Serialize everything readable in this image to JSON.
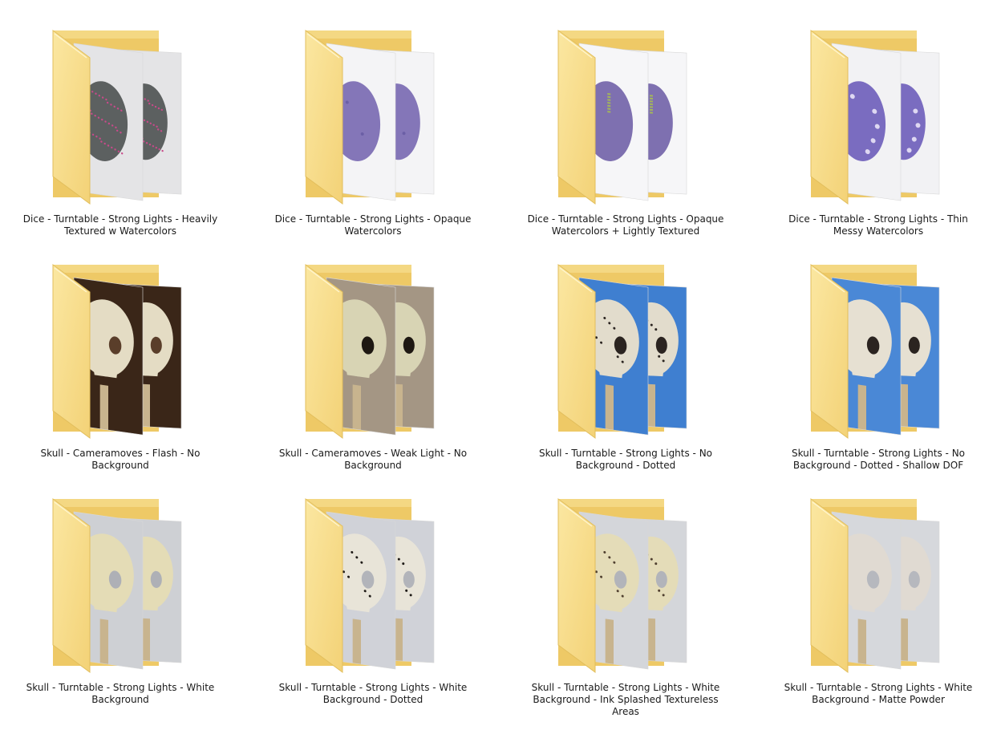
{
  "folders": [
    {
      "label": "Dice - Turntable - Strong Lights - Heavily Textured w Watercolors",
      "preview": "dice-speckled",
      "colors": {
        "bg": "#e4e4e6",
        "obj": "#5c6060",
        "fleck": "#c84a8a",
        "shade": "#9a9a9e"
      }
    },
    {
      "label": "Dice - Turntable - Strong Lights - Opaque Watercolors",
      "preview": "dice-purple",
      "colors": {
        "bg": "#f4f4f6",
        "obj": "#8476b8",
        "fleck": "#6b5fa6",
        "shade": "#b4b4bc"
      }
    },
    {
      "label": "Dice - Turntable - Strong Lights - Opaque Watercolors + Lightly Textured",
      "preview": "dice-purple-green",
      "colors": {
        "bg": "#f6f6f8",
        "obj": "#7e70b0",
        "fleck": "#a4b65a",
        "shade": "#b8b8c0"
      }
    },
    {
      "label": "Dice - Turntable - Strong Lights - Thin Messy Watercolors",
      "preview": "dice-purple-dots",
      "colors": {
        "bg": "#f2f2f4",
        "obj": "#7a6cc0",
        "fleck": "#ded8f2",
        "shade": "#b4b4bc"
      }
    },
    {
      "label": "Skull - Cameramoves - Flash - No Background",
      "preview": "skull-flash",
      "colors": {
        "bg": "#3a2618",
        "obj": "#e4dcc4",
        "fleck": "#a89878",
        "shade": "#5a3e2a"
      }
    },
    {
      "label": "Skull - Cameramoves - Weak Light - No Background",
      "preview": "skull-weak",
      "colors": {
        "bg": "#a49684",
        "obj": "#d8d4b4",
        "fleck": "#8e8a70",
        "shade": "#1e1812"
      }
    },
    {
      "label": "Skull - Turntable - Strong Lights - No Background - Dotted",
      "preview": "skull-blue",
      "colors": {
        "bg": "#3f7fd0",
        "obj": "#e2dccc",
        "fleck": "#2b2420",
        "shade": "#2d63ad"
      }
    },
    {
      "label": "Skull - Turntable - Strong Lights - No Background - Dotted - Shallow DOF",
      "preview": "skull-blue-dof",
      "colors": {
        "bg": "#4a88d6",
        "obj": "#e6e0d2",
        "fleck": "#2b2420",
        "shade": "#3266b0"
      }
    },
    {
      "label": "Skull - Turntable - Strong Lights - White Background",
      "preview": "skull-white",
      "colors": {
        "bg": "#ced0d4",
        "obj": "#e4dcb6",
        "fleck": "#6a5a34",
        "shade": "#aeb0b6"
      }
    },
    {
      "label": "Skull - Turntable - Strong Lights - White Background - Dotted",
      "preview": "skull-white-dotted",
      "colors": {
        "bg": "#d0d2d8",
        "obj": "#e8e4d8",
        "fleck": "#1e1a16",
        "shade": "#b2b4ba"
      }
    },
    {
      "label": "Skull - Turntable - Strong Lights - White Background - Ink Splashed Textureless Areas",
      "preview": "skull-white-ink",
      "colors": {
        "bg": "#d4d6da",
        "obj": "#e4dcb8",
        "fleck": "#504030",
        "shade": "#b2b4ba"
      }
    },
    {
      "label": "Skull - Turntable - Strong Lights - White Background - Matte Powder",
      "preview": "skull-white-matte",
      "colors": {
        "bg": "#d6d8dc",
        "obj": "#e0dad2",
        "fleck": "#a8a296",
        "shade": "#b6b8be"
      }
    }
  ]
}
